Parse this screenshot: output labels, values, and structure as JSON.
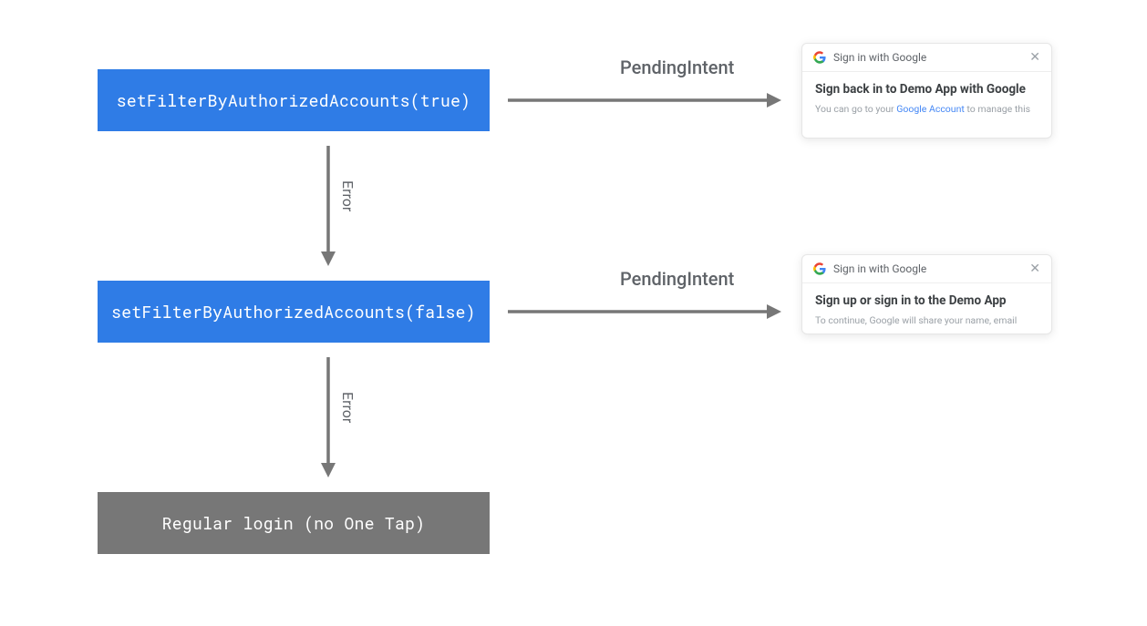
{
  "boxes": {
    "step1": "setFilterByAuthorizedAccounts(true)",
    "step2": "setFilterByAuthorizedAccounts(false)",
    "step3": "Regular login (no One Tap)"
  },
  "arrows": {
    "right1": "PendingIntent",
    "right2": "PendingIntent",
    "down1": "Error",
    "down2": "Error"
  },
  "panel1": {
    "header": "Sign in with Google",
    "title": "Sign back in to Demo App with Google",
    "sub_prefix": "You can go to your ",
    "sub_link": "Google Account",
    "sub_suffix": " to manage this"
  },
  "panel2": {
    "header": "Sign in with Google",
    "title": "Sign up or sign in to the Demo App",
    "sub": "To continue, Google will share your name, email"
  }
}
